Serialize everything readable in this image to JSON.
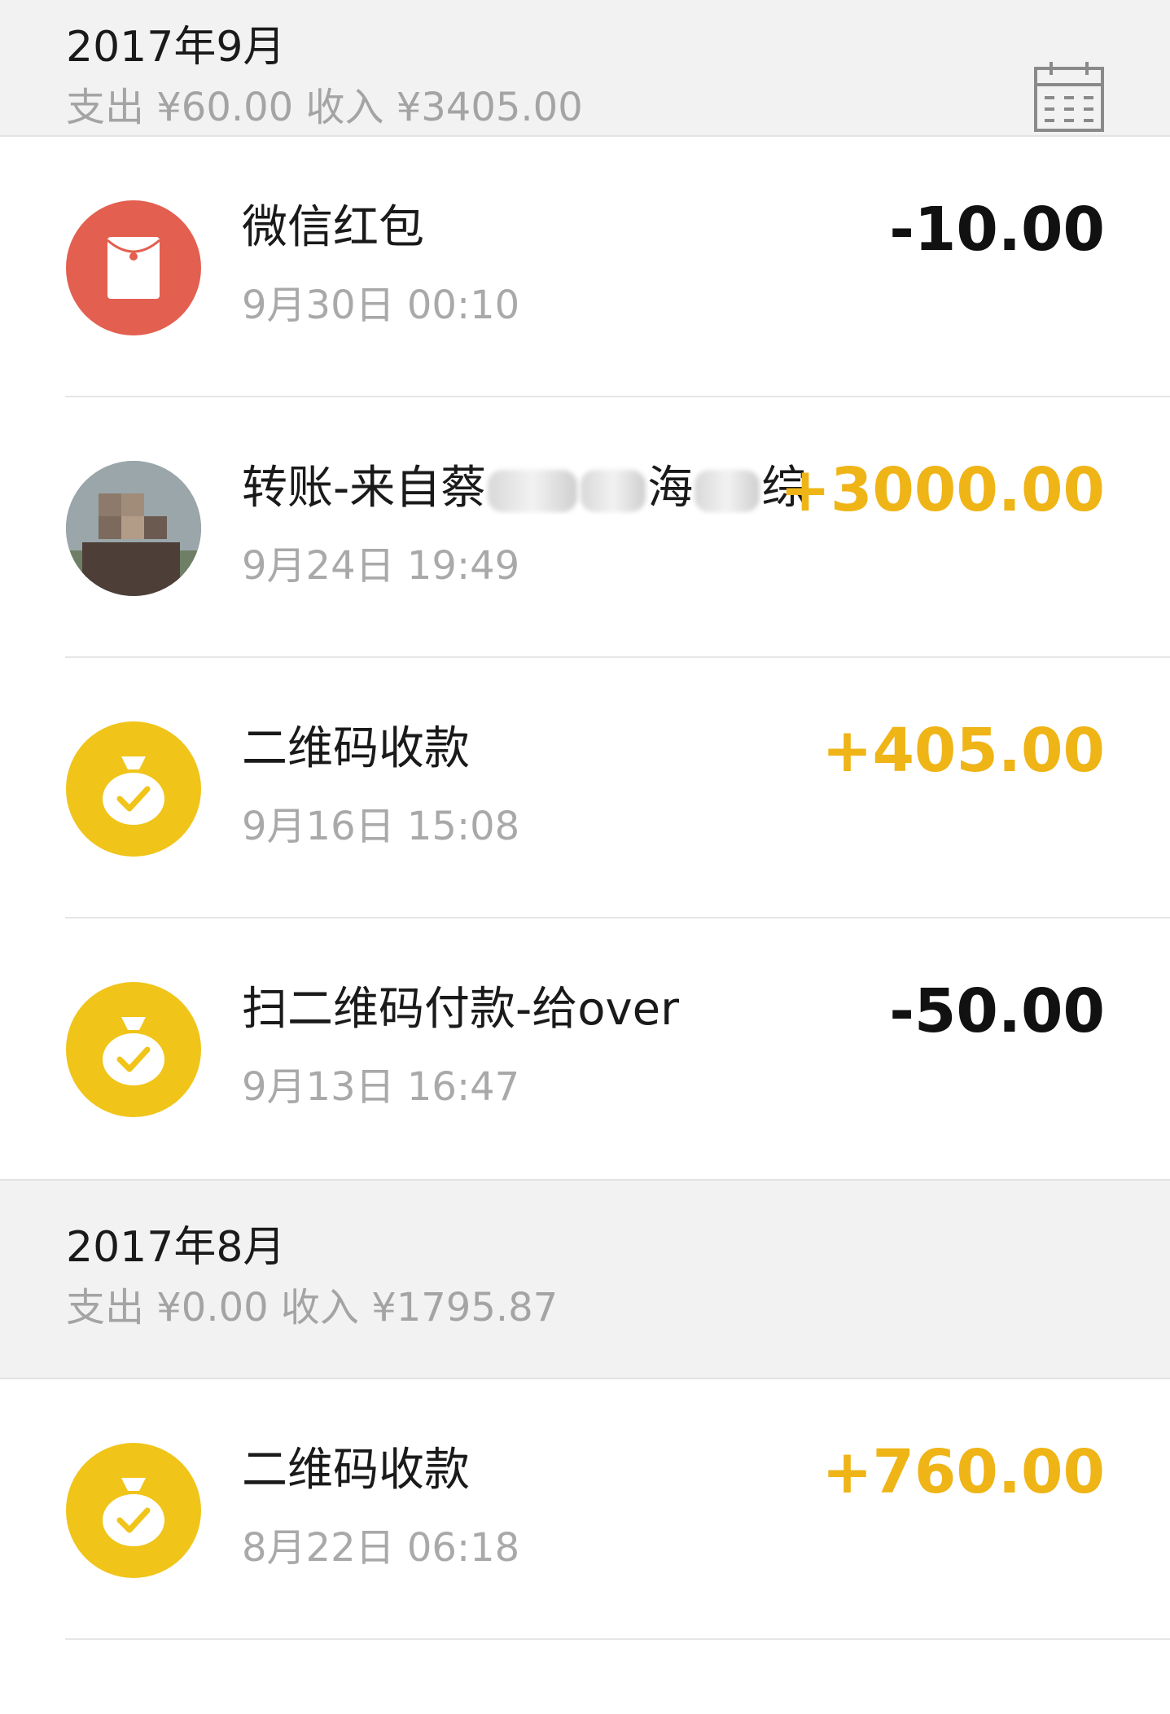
{
  "colors": {
    "header_bg": "#f2f2f2",
    "income": "#efb416",
    "expense": "#111111",
    "red_packet": "#e35f4f",
    "qr_yellow": "#f0c419"
  },
  "months": [
    {
      "title": "2017年9月",
      "summary": "支出 ¥60.00 收入 ¥3405.00",
      "calendar_icon": "calendar-icon",
      "transactions": [
        {
          "icon": "red-packet-icon",
          "title": "微信红包",
          "time": "9月30日 00:10",
          "amount": "-10.00",
          "type": "expense"
        },
        {
          "icon": "user-avatar",
          "title_parts": [
            "转账-来自蔡",
            "",
            "海",
            "综..."
          ],
          "time": "9月24日 19:49",
          "amount": "+3000.00",
          "type": "income"
        },
        {
          "icon": "money-bag-icon",
          "title": "二维码收款",
          "time": "9月16日 15:08",
          "amount": "+405.00",
          "type": "income"
        },
        {
          "icon": "money-bag-icon",
          "title": "扫二维码付款-给over",
          "time": "9月13日 16:47",
          "amount": "-50.00",
          "type": "expense"
        }
      ]
    },
    {
      "title": "2017年8月",
      "summary": "支出 ¥0.00 收入 ¥1795.87",
      "transactions": [
        {
          "icon": "money-bag-icon",
          "title": "二维码收款",
          "time": "8月22日 06:18",
          "amount": "+760.00",
          "type": "income"
        }
      ]
    }
  ]
}
